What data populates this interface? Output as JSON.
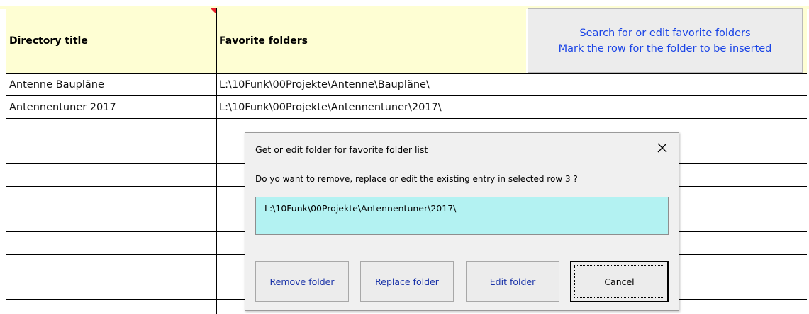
{
  "sheet": {
    "header": {
      "col1": "Directory title",
      "col2": "Favorite folders"
    },
    "search_button": {
      "line1": "Search for or edit favorite folders",
      "line2": "Mark the row for the folder to be inserted"
    },
    "rows": [
      {
        "title": "Antenne Baupläne",
        "folder": "L:\\10Funk\\00Projekte\\Antenne\\Baupläne\\"
      },
      {
        "title": "Antennentuner 2017",
        "folder": "L:\\10Funk\\00Projekte\\Antennentuner\\2017\\"
      }
    ]
  },
  "dialog": {
    "title": "Get or edit folder for favorite folder list",
    "message": "Do yo want to remove, replace or edit the existing entry in selected row 3 ?",
    "path_value": "L:\\10Funk\\00Projekte\\Antennentuner\\2017\\",
    "buttons": {
      "remove": "Remove folder",
      "replace": "Replace folder",
      "edit": "Edit folder",
      "cancel": "Cancel"
    }
  },
  "colors": {
    "header_fill": "#fefed3",
    "link_blue": "#1a44e6",
    "textbox_fill": "#b3f2f2"
  }
}
